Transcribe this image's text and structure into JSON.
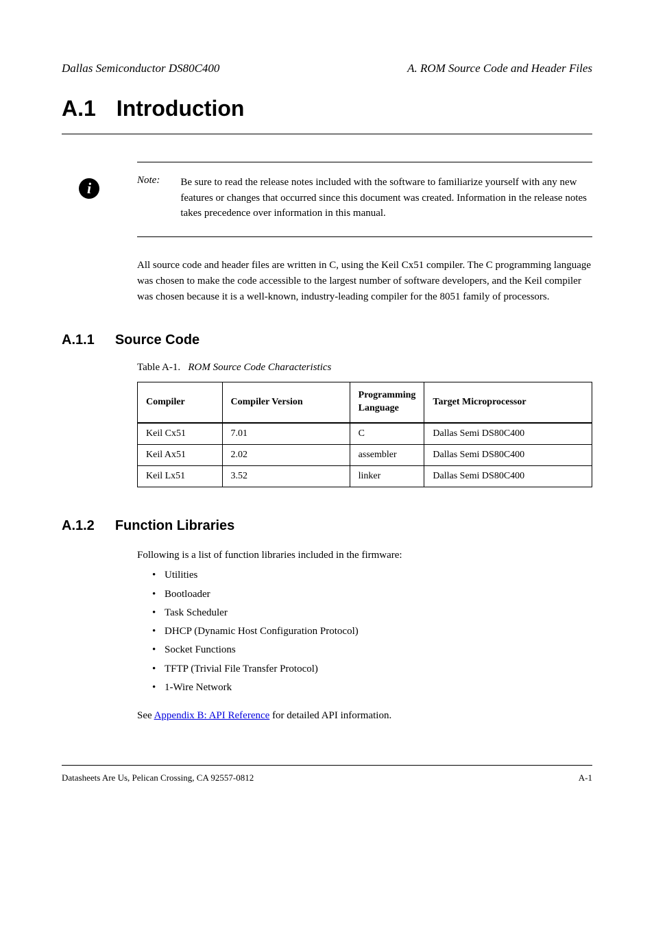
{
  "header": {
    "left": "Dallas Semiconductor DS80C400",
    "right": "A. ROM Source Code and Header Files"
  },
  "section": {
    "number": "A.1",
    "title": "Introduction"
  },
  "info_icon": "i",
  "note": {
    "label": "Note:",
    "text": "Be sure to read the release notes included with the software to familiarize yourself with any new features or changes that occurred since this document was created. Information in the release notes takes precedence over information in this manual."
  },
  "body_para_1": "All source code and header files are written in C, using the Keil Cx51 compiler. The C programming language was chosen to make the code accessible to the largest number of software developers, and the Keil compiler was chosen because it is a well-known, industry-leading compiler for the 8051 family of processors.",
  "subsection": {
    "number": "A.1.1",
    "title": "Source Code"
  },
  "table": {
    "caption_label": "Table A-1.",
    "caption_title": "ROM Source Code Characteristics",
    "headers": {
      "compiler": "Compiler",
      "compiler_version": "Compiler Version",
      "language": "Programming Language",
      "target": "Target Microprocessor"
    },
    "rows": [
      {
        "compiler": "Keil Cx51",
        "compiler_version": "7.01",
        "language": "C",
        "target": "Dallas Semi DS80C400"
      },
      {
        "compiler": "Keil Ax51",
        "compiler_version": "2.02",
        "language": "assembler",
        "target": "Dallas Semi DS80C400"
      },
      {
        "compiler": "Keil Lx51",
        "compiler_version": "3.52",
        "language": "linker",
        "target": "Dallas Semi DS80C400"
      }
    ]
  },
  "subsection2": {
    "number": "A.1.2",
    "title": "Function Libraries"
  },
  "libs": {
    "intro": "Following is a list of function libraries included in the firmware:",
    "items": [
      "Utilities",
      "Bootloader",
      "Task Scheduler",
      "DHCP (Dynamic Host Configuration Protocol)",
      "Socket Functions",
      "TFTP (Trivial File Transfer Protocol)",
      "1-Wire Network"
    ]
  },
  "body_para_2": "See ",
  "link_text": "Appendix B: API Reference",
  "body_para_3": " for detailed API information.",
  "footer": {
    "left": "Datasheets Are Us, Pelican Crossing, CA 92557-0812",
    "right": "A-1"
  }
}
